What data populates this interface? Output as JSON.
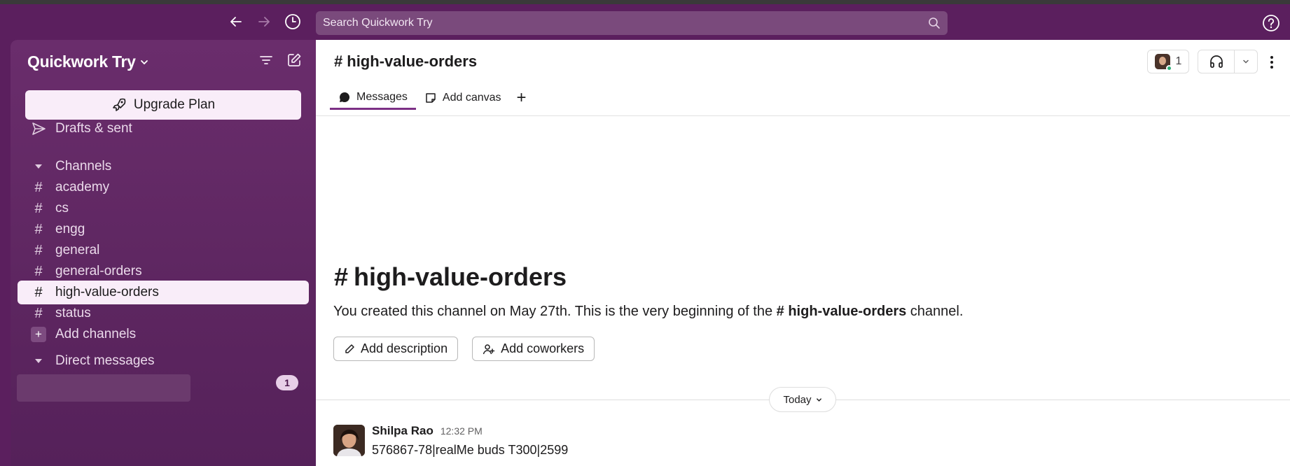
{
  "topbar": {
    "search_placeholder": "Search Quickwork Try",
    "back_icon": "arrow-left-icon",
    "forward_icon": "arrow-right-icon",
    "history_icon": "clock-icon",
    "help_icon": "help-icon"
  },
  "sidebar": {
    "workspace_name": "Quickwork Try",
    "upgrade_label": "Upgrade Plan",
    "drafts_label": "Drafts & sent",
    "channels_header": "Channels",
    "channels": [
      {
        "name": "academy"
      },
      {
        "name": "cs"
      },
      {
        "name": "engg"
      },
      {
        "name": "general"
      },
      {
        "name": "general-orders"
      },
      {
        "name": "high-value-orders",
        "active": true
      },
      {
        "name": "status"
      }
    ],
    "add_channels_label": "Add channels",
    "dm_header": "Direct messages",
    "dm_badge": "1"
  },
  "channel": {
    "name": "high-value-orders",
    "member_count": "1",
    "tabs": [
      "Messages",
      "Add canvas"
    ],
    "intro_title": "high-value-orders",
    "intro_prefix": "You created this channel on May 27th. This is the very beginning of the ",
    "intro_channel": "high-value-orders",
    "intro_suffix": " channel.",
    "add_description_label": "Add description",
    "add_coworkers_label": "Add coworkers",
    "day_divider": "Today"
  },
  "messages": [
    {
      "author": "Shilpa Rao",
      "time": "12:32 PM",
      "text": "576867-78|realMe buds T300|2599"
    }
  ],
  "colors": {
    "sidebar_bg": "#5b1f5e",
    "active_row": "#f9edf9",
    "tab_accent": "#7c3085",
    "online": "#2bac76"
  }
}
